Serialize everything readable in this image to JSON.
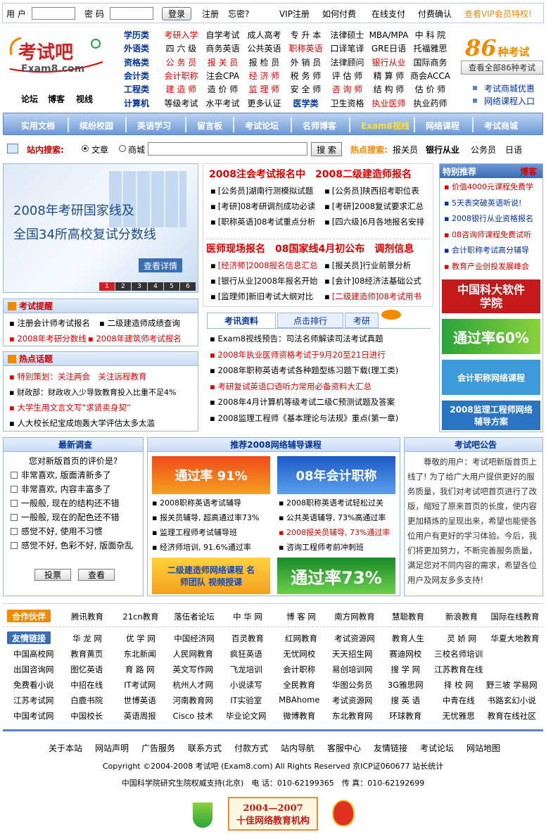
{
  "topbar": {
    "user_label": "用 户",
    "pass_label": "密 码",
    "login_btn": "登录",
    "register": "注册",
    "forgot": "忘密?",
    "links": [
      "VIP注册",
      "如何付费",
      "在线支付",
      "付费确认"
    ],
    "vip": "查看VIP会员特权!"
  },
  "logo": {
    "text": "考试吧",
    "sub": "Exam8.com",
    "links": [
      "论坛",
      "博客",
      "视线"
    ]
  },
  "categories": [
    {
      "name": "学历类",
      "items": [
        "考研入学",
        "自学考试",
        "成人高考",
        "专 升 本",
        "法律硕士",
        "MBA/MPA",
        "中 科 院"
      ],
      "red": [
        0
      ]
    },
    {
      "name": "外语类",
      "items": [
        "四 六 级",
        "商务英语",
        "公共英语",
        "职称英语",
        "口译笔译",
        "GRE日语",
        "托福雅思"
      ],
      "red": [
        3
      ]
    },
    {
      "name": "资格类",
      "items": [
        "公 务 员",
        "报 关 员",
        "报 检 员",
        "外 销 员",
        "法律顾问",
        "银行从业",
        "国际商务"
      ],
      "red": [
        0,
        1,
        5
      ]
    },
    {
      "name": "会计类",
      "items": [
        "会计职称",
        "注会CPA",
        "经 济 师",
        "税 务 师",
        "评 估 师",
        "精 算 师",
        "商会ACCA"
      ],
      "red": [
        0,
        2
      ]
    },
    {
      "name": "工程类",
      "items": [
        "建 造 师",
        "造 价 师",
        "监 理 师",
        "安 全 师",
        "咨 询 师",
        "结 构 师",
        "估 价 师"
      ],
      "red": [
        0,
        2,
        4
      ]
    },
    {
      "name": "计算机",
      "items": [
        "等级考试",
        "水平考试",
        "更多认证",
        "医学类",
        "卫生资格",
        "执业医师",
        "执业药师"
      ],
      "red": [
        5
      ]
    }
  ],
  "exam86": {
    "num": "86",
    "label": "种考试",
    "btn": "查看全部86种考试"
  },
  "side_links": [
    "考试商城优惠",
    "网络课程入口"
  ],
  "nav": [
    "实用文档",
    "缤纷校园",
    "英语学习",
    "留言板",
    "考试论坛",
    "名师博客",
    "Exam8视线",
    "网络课程",
    "考试商城"
  ],
  "search": {
    "label": "站内搜索:",
    "radio1": "文章",
    "radio2": "商城",
    "btn": "搜 索",
    "hot_label": "热点搜索:",
    "hot": [
      "报关员",
      "银行从业",
      "公务员",
      "日语"
    ]
  },
  "hero": {
    "line1": "2008年考研国家线及",
    "line2": "全国34所高校复试分数线",
    "btn": "查看详情",
    "pages": [
      "1",
      "2",
      "3",
      "4",
      "5",
      "6"
    ]
  },
  "news_head1": "2008注会考试报名中　2008二级建造师报名",
  "news1": [
    [
      "[公务员]湖南行测模拟试题",
      "[公务员]陕西招考职位表"
    ],
    [
      "[考研]08考研调剂成功必读",
      "[考研]2008复试要求汇总"
    ],
    [
      "[职称英语]08考试重点分析",
      "[四六级]6月各地报名安排"
    ]
  ],
  "news_head2": "医师现场报名　08国家线4月初公布　调剂信息",
  "news2": [
    [
      "[经济师]2008报名信息汇总",
      "[报关员]行业前景分析"
    ],
    [
      "[银行从业]2008年报名开始",
      "[会计]08经济法基础公式"
    ],
    [
      "[监理师]新旧考试大纲对比",
      "[二级建造师]08考试用书"
    ]
  ],
  "remind": {
    "title": "考试提醒",
    "items": [
      "注册会计师考试报名",
      "二级建造师成绩查询",
      "2008年考研分数线",
      "2008年建筑师考试报名"
    ]
  },
  "hot": {
    "title": "热点话题",
    "items": [
      "特别策划：关注两会　关注远程教育",
      "财政部：财政收入少导致教育投入比重不足4%",
      "大学生用文言文写“求贤卖身契”",
      "人大校长纪宝成炮轰大学评估太多太滥"
    ]
  },
  "tabs": [
    "考讯资料",
    "点击排行",
    "考研"
  ],
  "tab_items": [
    "Exam8视线预告：司法名师解读司法考试真题",
    "2008年执业医师资格考试于9月20至21日进行",
    "2008年职称英语考试各种题型练习题下载(理工类)",
    "考研复试英语口语听力常用必备资料大汇总",
    "2008年4月计算机等级考试二级C预测试题及答案",
    "2008监理工程师《基本理论与法规》重点(第一章)"
  ],
  "special": {
    "title": "特别推荐",
    "blog": "博客",
    "items": [
      "价值4000元课程免费学",
      "5天表突破英语听说!",
      "2008银行从业资格报名",
      "08咨询师课程免费试听",
      "会计职称考试高分辅导",
      "教育产业创投发展峰会"
    ],
    "banners": [
      "中国科大软件学院",
      "通过率60%",
      "会计职称网络课程",
      "2008监理工程师网络辅导方案"
    ]
  },
  "survey": {
    "title": "最新调查",
    "question": "您对新版首页的评价是?",
    "options": [
      "非常喜欢, 版面清新多了",
      "非常喜欢, 内容丰富多了",
      "一般般, 现在的结构还不错",
      "一般般, 现在的配色还不错",
      "感觉不好, 使用不习惯",
      "感觉不好, 色彩不好, 版面杂乱"
    ],
    "vote": "投票",
    "view": "查看"
  },
  "courses": {
    "title": "推荐2008网络辅导课程",
    "banner1": "通过率 91%",
    "banner2": "08年会计职称",
    "left": [
      "2008职称英语考试辅导",
      "报关员辅导, 超高通过率73%",
      "监理工程师考试辅导班",
      "经济师培训, 91.6%通过率"
    ],
    "right": [
      "2008职称英语考试轻松过关",
      "公共英语辅导, 73%高通过率",
      "2008报关员辅导, 73%通过率",
      "咨询工程师考前冲刺班"
    ],
    "banner3": "二级建造师网络课程 名师团队 视频授课",
    "banner4": "通过率73%"
  },
  "notice": {
    "title": "考试吧公告",
    "text": "尊敬的用户：考试吧新版首页上线了! 为了给广大用户提供更好的服务质量，我们对考试吧首页进行了改版，缩短了原来首页的长度，使内容更加精炼的呈现出来，希望也能使各位用户有更好的学习体验。今后，我们将更加努力，不断完善服务质量，满足您对不同内容的需求，希望各位用户及网友多多支持!"
  },
  "partners": {
    "label": "合作伙伴",
    "items": [
      "腾讯教育",
      "21cn教育",
      "落伍者论坛",
      "中 华 网",
      "博 客 网",
      "南方网教育",
      "慧聪教育",
      "新浪教育",
      "国际在线教育"
    ]
  },
  "friends": {
    "label": "友情链接",
    "row0": [
      "华 龙 网",
      "优 学 网",
      "中国经济网",
      "百灵教育",
      "红网教育",
      "考试资源网",
      "教育人生",
      "灵 娇 网",
      "华夏大地教育"
    ],
    "rows": [
      [
        "中国高校网",
        "教育黄页",
        "东北新闻",
        "人民网教育",
        "疯狂英语",
        "无忧网校",
        "天天招生网",
        "赛迪网校",
        "三校名师培训"
      ],
      [
        "出国咨询网",
        "图忆英语",
        "育 路 网",
        "英文写作网",
        "飞龙培训",
        "会计职称",
        "易创培训网",
        "搜 学 网",
        "江苏教育在线"
      ],
      [
        "免费看小说",
        "中招在线",
        "IT考试网",
        "杭州人才网",
        "小说读写",
        "全民教育",
        "华图公务员",
        "3G雅思网",
        "择 校 网",
        "野三坡 学易网"
      ],
      [
        "江苏考试网",
        "白鹿书院",
        "世博英语",
        "河南教育网",
        "IT实验室",
        "MBAhome",
        "考试资源网",
        "搜 英 语",
        "中青在线",
        "书路玄幻小说"
      ],
      [
        "中国考试网",
        "中国校长",
        "英语周报",
        "Cisco 技术",
        "毕业论文网",
        "微博教育",
        "东北教育网",
        "环球教育",
        "无忧雅思",
        "教育在线社区"
      ]
    ]
  },
  "footer": {
    "links": [
      "关于本站",
      "网站声明",
      "广告服务",
      "联系方式",
      "付款方式",
      "站内导航",
      "客服中心",
      "友情链接",
      "考试论坛",
      "网站地图"
    ],
    "copyright": "Copyright ©2004-2008 考试吧 (Exam8.com) All Rights Reserved 京ICP证060677 站长统计",
    "support": "中国科学院研究生院权威支持(北京)　电 话：010-62199365　传 真：010-62192699",
    "award1": "2004—2007",
    "award2": "十佳网络教育机构"
  },
  "colors": {
    "accent": "#003399",
    "red": "#e00000",
    "nav_top": "#bcd4f2",
    "nav_bottom": "#6d98d6",
    "border": "#9ab9e2",
    "orange": "#f28a00",
    "green": "#2aa33a"
  }
}
